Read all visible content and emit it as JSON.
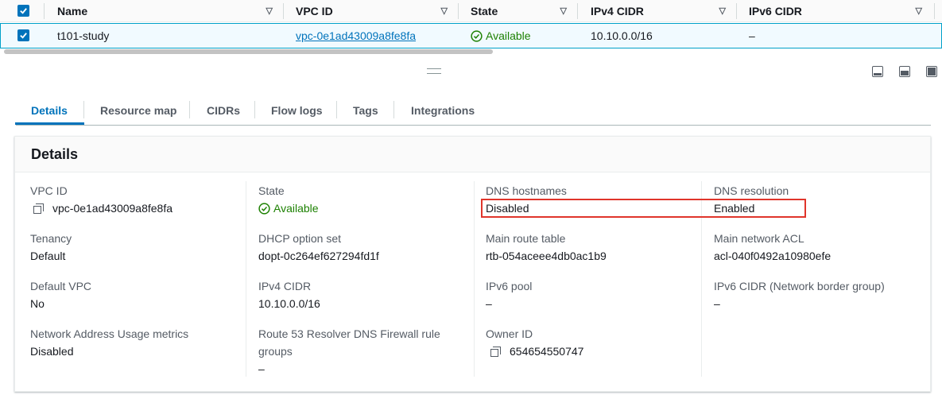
{
  "table": {
    "columns": [
      "Name",
      "VPC ID",
      "State",
      "IPv4 CIDR",
      "IPv6 CIDR"
    ],
    "row": {
      "name": "t101-study",
      "vpc_id": "vpc-0e1ad43009a8fe8fa",
      "state": "Available",
      "ipv4_cidr": "10.10.0.0/16",
      "ipv6_cidr": "–"
    }
  },
  "tabs": [
    "Details",
    "Resource map",
    "CIDRs",
    "Flow logs",
    "Tags",
    "Integrations"
  ],
  "details": {
    "title": "Details",
    "col1": [
      {
        "key": "VPC ID",
        "value": "vpc-0e1ad43009a8fe8fa"
      },
      {
        "key": "Tenancy",
        "value": "Default"
      },
      {
        "key": "Default VPC",
        "value": "No"
      },
      {
        "key": "Network Address Usage metrics",
        "value": "Disabled"
      }
    ],
    "col2": [
      {
        "key": "State",
        "value": "Available"
      },
      {
        "key": "DHCP option set",
        "value": "dopt-0c264ef627294fd1f"
      },
      {
        "key": "IPv4 CIDR",
        "value": "10.10.0.0/16"
      },
      {
        "key": "Route 53 Resolver DNS Firewall rule",
        "key2": "groups",
        "value": "–"
      }
    ],
    "col3": [
      {
        "key": "DNS hostnames",
        "value": "Disabled"
      },
      {
        "key": "Main route table",
        "value": "rtb-054aceee4db0ac1b9"
      },
      {
        "key": "IPv6 pool",
        "value": "–"
      },
      {
        "key": "Owner ID",
        "value": "654654550747"
      }
    ],
    "col4": [
      {
        "key": "DNS resolution",
        "value": "Enabled"
      },
      {
        "key": "Main network ACL",
        "value": "acl-040f0492a10980efe"
      },
      {
        "key": "IPv6 CIDR (Network border group)",
        "value": "–"
      }
    ]
  },
  "colors": {
    "link": "#0073bb",
    "success": "#1d8102",
    "highlight": "#e0352b",
    "selected_row_bg": "#f1faff"
  },
  "icons": [
    "checkbox-checked-icon",
    "sort-caret-icon",
    "status-success-icon",
    "copy-icon",
    "drag-handle-icon",
    "split-view-icons"
  ]
}
